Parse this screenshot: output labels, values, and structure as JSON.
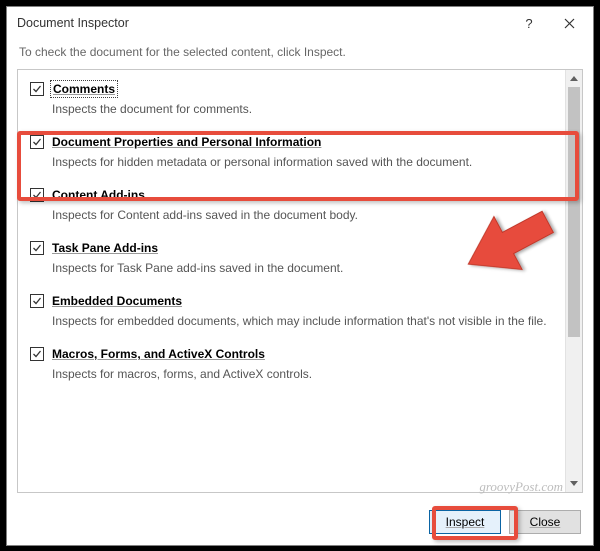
{
  "dialog": {
    "title": "Document Inspector",
    "subtitle": "To check the document for the selected content, click Inspect."
  },
  "items": [
    {
      "title": "Comments",
      "desc": "Inspects the document for comments.",
      "checked": true,
      "focused": true
    },
    {
      "title": "Document Properties and Personal Information",
      "desc": "Inspects for hidden metadata or personal information saved with the document.",
      "checked": true,
      "focused": false
    },
    {
      "title": "Content Add-ins",
      "desc": "Inspects for Content add-ins saved in the document body.",
      "checked": true,
      "focused": false
    },
    {
      "title": "Task Pane Add-ins",
      "desc": "Inspects for Task Pane add-ins saved in the document.",
      "checked": true,
      "focused": false
    },
    {
      "title": "Embedded Documents",
      "desc": "Inspects for embedded documents, which may include information that's not visible in the file.",
      "checked": true,
      "focused": false
    },
    {
      "title": "Macros, Forms, and ActiveX Controls",
      "desc": "Inspects for macros, forms, and ActiveX controls.",
      "checked": true,
      "focused": false
    }
  ],
  "buttons": {
    "inspect": "Inspect",
    "close": "Close"
  },
  "watermark": "groovyPost.com"
}
